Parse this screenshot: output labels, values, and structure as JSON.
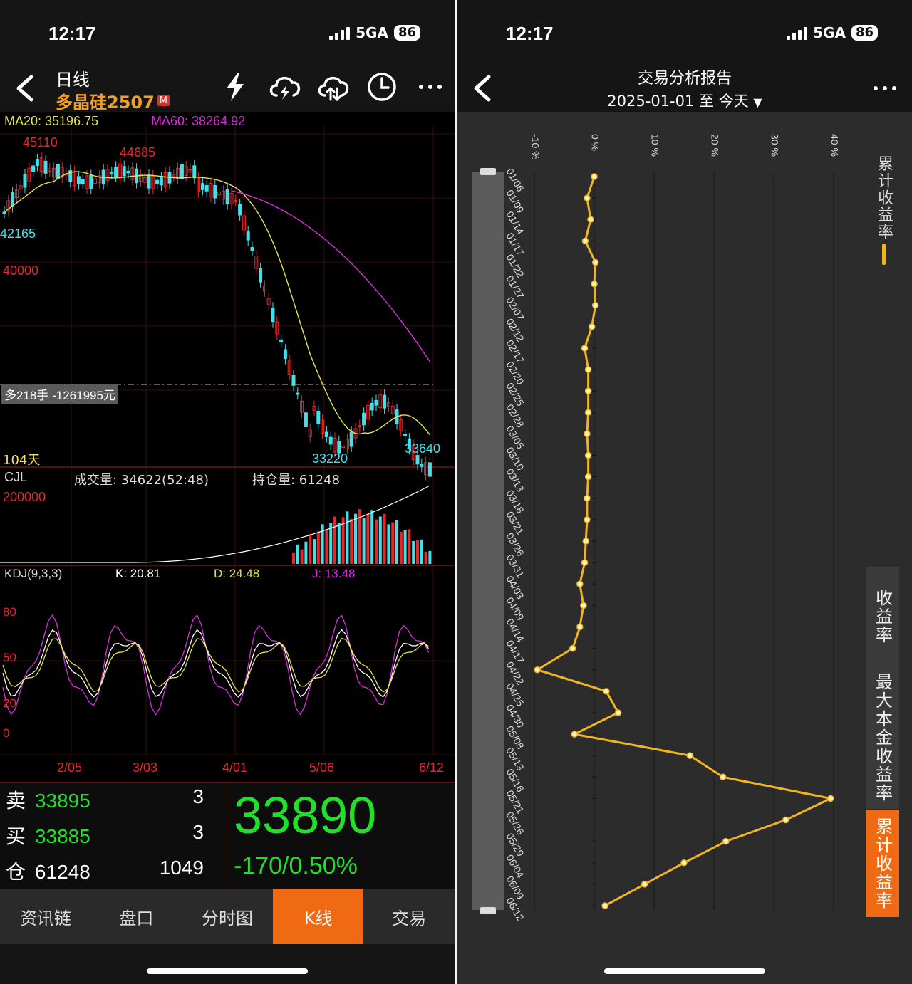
{
  "status": {
    "time": "12:17",
    "network": "5GA",
    "battery": "86"
  },
  "left": {
    "header": {
      "period": "日线",
      "contract": "多晶硅2507",
      "exchange_badge": "M"
    },
    "ma": {
      "ma20": "MA20: 35196.75",
      "ma60": "MA60: 38264.92"
    },
    "price_labels": {
      "high1": "45110",
      "high2": "44685",
      "left_low": "42165",
      "level": "40000",
      "low1": "33220",
      "low2": "33640",
      "days": "104天"
    },
    "position_line": "多218手 -1261995元",
    "volume": {
      "title": "CJL",
      "volume": "成交量: 34622(52:48)",
      "open_interest": "持仓量: 61248",
      "scale": "200000"
    },
    "kdj": {
      "title": "KDJ(9,3,3)",
      "k": "K: 20.81",
      "d": "D: 24.48",
      "j": "J: 13.48",
      "ticks": [
        "80",
        "50",
        "20",
        "0"
      ]
    },
    "dates": [
      "2/05",
      "3/03",
      "4/01",
      "5/06",
      "6/12"
    ],
    "quote": {
      "sell_label": "卖",
      "sell_price": "33895",
      "sell_qty": "3",
      "buy_label": "买",
      "buy_price": "33885",
      "buy_qty": "3",
      "oi_label": "仓",
      "oi_value": "61248",
      "oi_change": "1049",
      "last": "33890",
      "change": "-170/0.50%"
    },
    "tabs": [
      "资讯链",
      "盘口",
      "分时图",
      "K线",
      "交易"
    ],
    "colors": {
      "up": "#e8262c",
      "down": "#44e0ea",
      "ma20": "#e6e24a",
      "ma60": "#d92fd9",
      "green": "#22e02a"
    }
  },
  "right": {
    "title": "交易分析报告",
    "date_range": "2025-01-01 至 今天",
    "x_ticks": [
      "-10 %",
      "0 %",
      "10 %",
      "20 %",
      "30 %",
      "40 %"
    ],
    "legend": "累计收益率",
    "side_tabs": [
      "收益率",
      "最大本金收益率",
      "累计收益率"
    ],
    "chart_data": {
      "type": "line",
      "title": "",
      "series": [
        {
          "name": "累计收益率",
          "color": "#f2b51f"
        }
      ],
      "dates": [
        "01/06",
        "01/09",
        "01/14",
        "01/17",
        "01/22",
        "01/27",
        "02/07",
        "02/12",
        "02/17",
        "02/20",
        "02/25",
        "02/28",
        "03/05",
        "03/10",
        "03/13",
        "03/18",
        "03/21",
        "03/26",
        "03/31",
        "04/03",
        "04/09",
        "04/14",
        "04/17",
        "04/22",
        "04/25",
        "04/30",
        "05/08",
        "05/13",
        "05/16",
        "05/21",
        "05/26",
        "05/29",
        "06/04",
        "06/09",
        "06/12"
      ],
      "values": [
        0.0,
        -1.2,
        -0.6,
        -1.5,
        0.2,
        0.0,
        0.2,
        -0.4,
        -1.6,
        -1.0,
        -1.0,
        -1.0,
        -1.2,
        -1.0,
        -1.0,
        -1.2,
        -1.2,
        -1.4,
        -1.6,
        -2.4,
        -1.8,
        -2.4,
        -3.6,
        -9.5,
        2.0,
        4.0,
        -3.3,
        16.0,
        21.5,
        39.5,
        32.0,
        22.0,
        15.0,
        8.4,
        1.8
      ],
      "xlim": [
        -10,
        40
      ],
      "xlabel": "",
      "ylabel": ""
    }
  }
}
